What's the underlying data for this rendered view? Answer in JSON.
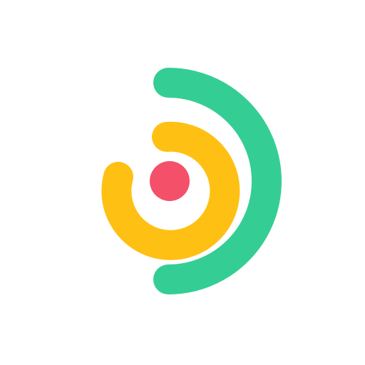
{
  "logo": {
    "icon": "concentric-arcs-logo-icon",
    "colors": {
      "background": "#ffffff",
      "outer_arc": "#34CE95",
      "middle_arc": "#FFC014",
      "center_dot": "#F4506A"
    }
  }
}
